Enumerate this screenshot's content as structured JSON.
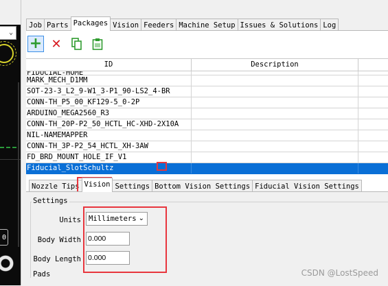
{
  "main_tabs": [
    "Job",
    "Parts",
    "Packages",
    "Vision",
    "Feeders",
    "Machine Setup",
    "Issues & Solutions",
    "Log"
  ],
  "active_main_tab": "Packages",
  "toolbar": {
    "add_icon": "plus-icon",
    "delete_icon": "x-icon",
    "copy_icon": "copy-icon",
    "paste_icon": "clipboard-icon"
  },
  "table": {
    "columns": [
      "ID",
      "Description",
      ""
    ],
    "rows": [
      {
        "id": "FIDUCIAL-HOME",
        "description": "",
        "partial": true
      },
      {
        "id": "MARK_MECH_D1MM",
        "description": ""
      },
      {
        "id": "SOT-23-3_L2_9-W1_3-P1_90-LS2_4-BR",
        "description": ""
      },
      {
        "id": "CONN-TH_P5_00_KF129-5_0-2P",
        "description": ""
      },
      {
        "id": "ARDUINO_MEGA2560_R3",
        "description": ""
      },
      {
        "id": "CONN-TH_20P-P2_50_HCTL_HC-XHD-2X10A",
        "description": ""
      },
      {
        "id": "NIL-NAMEMAPPER",
        "description": ""
      },
      {
        "id": "CONN-TH_3P-P2_54_HCTL_XH-3AW",
        "description": ""
      },
      {
        "id": "FD_BRD_MOUNT_HOLE_IF_V1",
        "description": ""
      },
      {
        "id": "Fiducial_SlotSchultz",
        "description": "",
        "selected": true
      }
    ]
  },
  "sub_tabs": [
    "Nozzle Tips",
    "Vision",
    "Settings",
    "Bottom Vision Settings",
    "Fiducial Vision Settings"
  ],
  "active_sub_tab": "Vision",
  "settings": {
    "group_label": "Settings",
    "units_label": "Units",
    "units_value": "Millimeters",
    "body_width_label": "Body Width",
    "body_width_value": "0.000",
    "body_length_label": "Body Length",
    "body_length_value": "0.000"
  },
  "pads_label": "Pads",
  "left_panel": {
    "zero_button": "0"
  },
  "watermark": "CSDN @LostSpeed",
  "colors": {
    "selection": "#0a6fd6",
    "highlight": "#e8353d",
    "add_green": "#2e9b2e",
    "delete_red": "#d71920"
  }
}
